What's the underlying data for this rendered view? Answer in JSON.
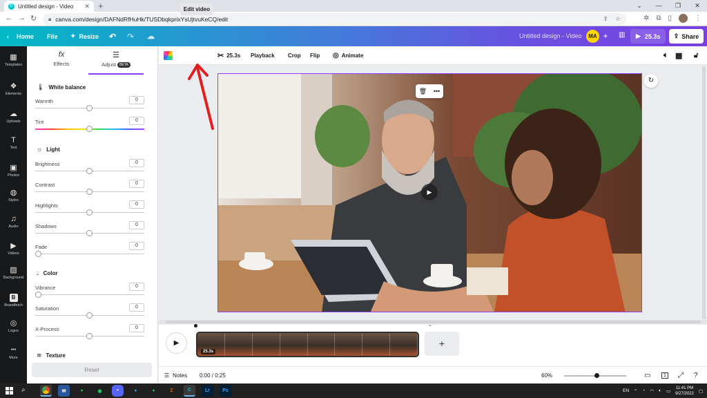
{
  "browser": {
    "tab_title": "Untitled design - Video",
    "url": "canva.com/design/DAFNdRfHuHk/TUSDbqkprixYsUjtvuKeCQ/edit"
  },
  "topbar": {
    "home": "Home",
    "file": "File",
    "resize": "Resize",
    "design_title": "Untitled design - Video",
    "avatar_initials": "MA",
    "duration": "25.3s",
    "share": "Share"
  },
  "rail": [
    {
      "label": "Templates",
      "icon": "templates-icon",
      "glyph": "▦"
    },
    {
      "label": "Elements",
      "icon": "elements-icon",
      "glyph": "❖"
    },
    {
      "label": "Uploads",
      "icon": "uploads-icon",
      "glyph": "☁"
    },
    {
      "label": "Text",
      "icon": "text-icon",
      "glyph": "T"
    },
    {
      "label": "Photos",
      "icon": "photos-icon",
      "glyph": "▣"
    },
    {
      "label": "Styles",
      "icon": "styles-icon",
      "glyph": "◍"
    },
    {
      "label": "Audio",
      "icon": "audio-icon",
      "glyph": "♫"
    },
    {
      "label": "Videos",
      "icon": "videos-icon",
      "glyph": "▶"
    },
    {
      "label": "Background",
      "icon": "background-icon",
      "glyph": "▨"
    },
    {
      "label": "Brandfetch",
      "icon": "brandfetch-icon",
      "glyph": "B"
    },
    {
      "label": "Logos",
      "icon": "logos-icon",
      "glyph": "◎"
    },
    {
      "label": "More",
      "icon": "more-icon",
      "glyph": "•••"
    }
  ],
  "panel": {
    "tab_effects": "Effects",
    "tab_adjust": "Adjust",
    "beta": "BETA",
    "white_balance": "White balance",
    "light": "Light",
    "color": "Color",
    "texture": "Texture",
    "reset": "Reset",
    "sliders": [
      {
        "label": "Warmth",
        "value": "0"
      },
      {
        "label": "Tint",
        "value": "0"
      },
      {
        "label": "Brightness",
        "value": "0"
      },
      {
        "label": "Contrast",
        "value": "0"
      },
      {
        "label": "Highlights",
        "value": "0"
      },
      {
        "label": "Shadows",
        "value": "0"
      },
      {
        "label": "Fade",
        "value": "0"
      },
      {
        "label": "Vibrance",
        "value": "0"
      },
      {
        "label": "Saturation",
        "value": "0"
      },
      {
        "label": "X-Process",
        "value": "0"
      }
    ]
  },
  "toolbar": {
    "edit_video": "Edit video",
    "trim_duration": "25.3s",
    "playback": "Playback",
    "crop": "Crop",
    "flip": "Flip",
    "animate": "Animate"
  },
  "timeline": {
    "clip_duration": "25.3s"
  },
  "status": {
    "notes": "Notes",
    "time": "0:00 / 0:25",
    "zoom": "60%",
    "page_number": "1"
  },
  "taskbar": {
    "lang": "EN",
    "time": "11:41 PM",
    "date": "9/27/2022"
  },
  "colors": {
    "accent": "#8b3dff",
    "annotation": "#e02020"
  }
}
